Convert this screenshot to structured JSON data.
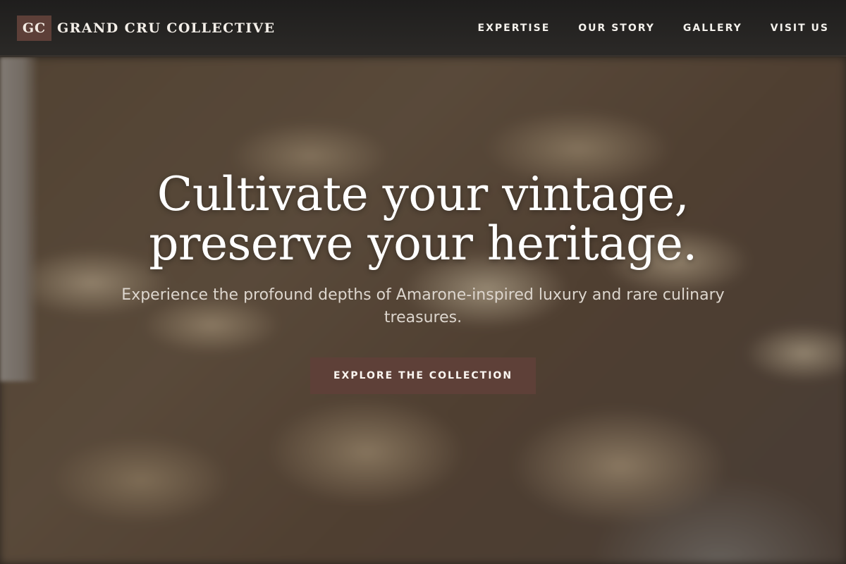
{
  "header": {
    "brand_mark": "GC",
    "brand_name": "GRAND CRU COLLECTIVE",
    "nav": [
      {
        "label": "EXPERTISE"
      },
      {
        "label": "OUR STORY"
      },
      {
        "label": "GALLERY"
      },
      {
        "label": "VISIT US"
      }
    ]
  },
  "hero": {
    "title_line1": "Cultivate your vintage,",
    "title_line2": "preserve your heritage.",
    "subtitle": "Experience the profound depths of Amarone-inspired luxury and rare culinary treasures.",
    "cta_label": "EXPLORE THE COLLECTION"
  },
  "colors": {
    "header_bg": "#232120",
    "accent": "#5e4038",
    "text_light": "#ffffff"
  }
}
